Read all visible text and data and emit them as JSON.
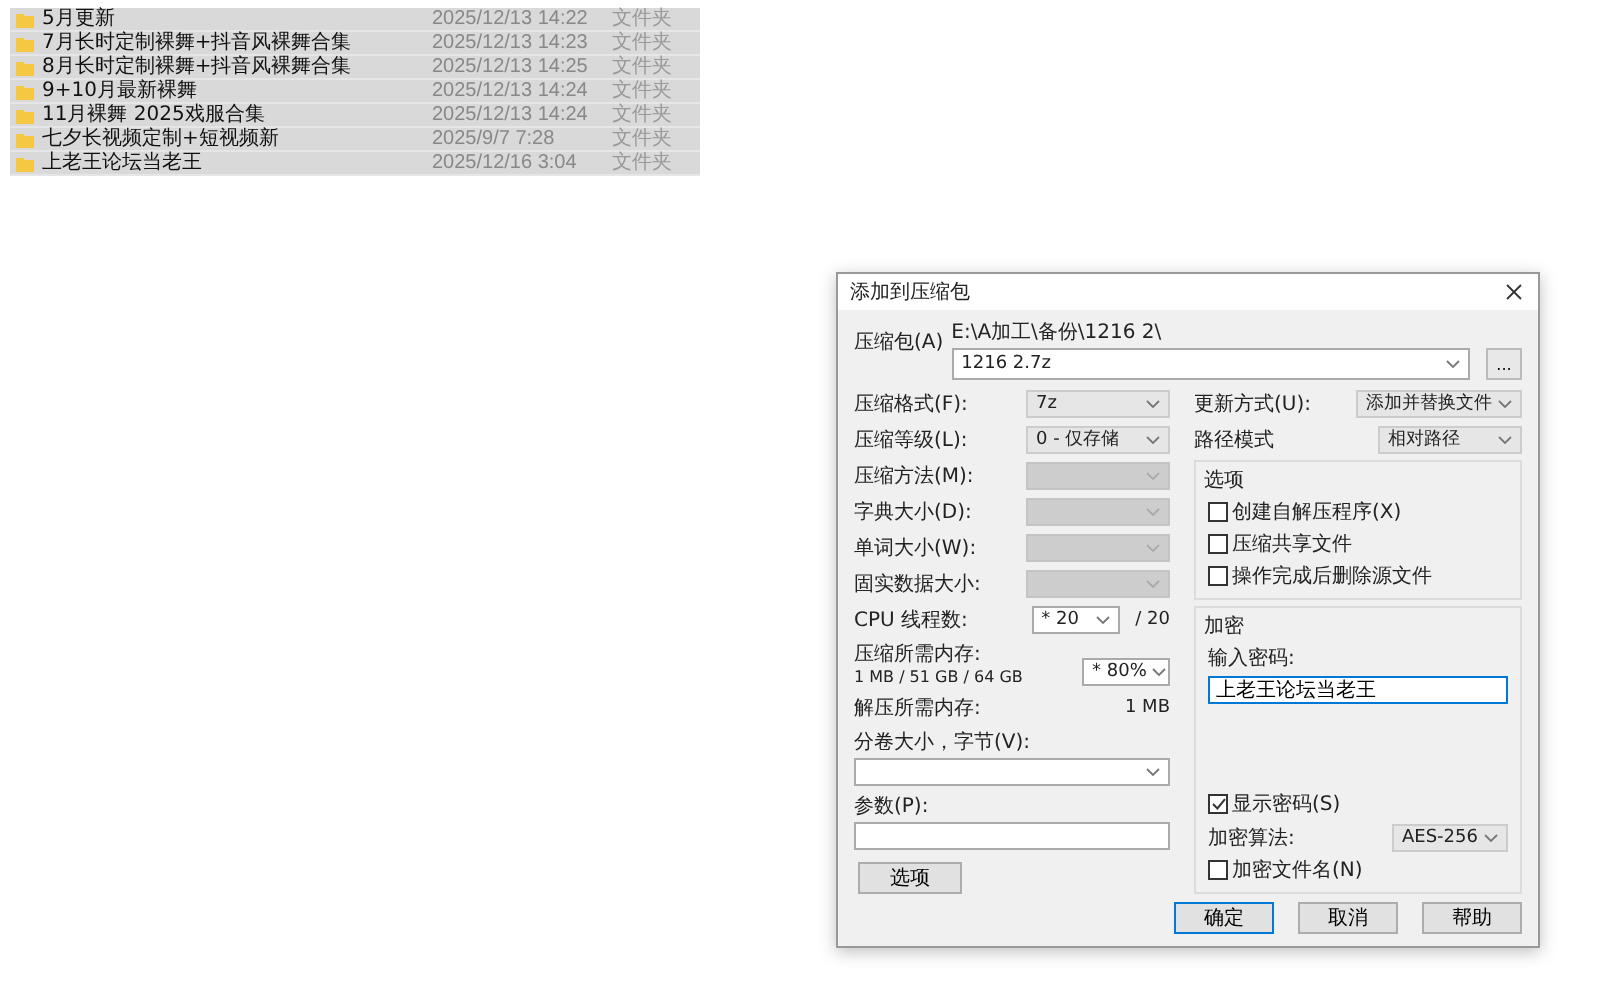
{
  "file_list": {
    "rows": [
      {
        "name": "5月更新",
        "date": "2025/12/13 14:22",
        "type": "文件夹",
        "selected": true
      },
      {
        "name": "7月长时定制裸舞+抖音风裸舞合集",
        "date": "2025/12/13 14:23",
        "type": "文件夹",
        "selected": true
      },
      {
        "name": "8月长时定制裸舞+抖音风裸舞合集",
        "date": "2025/12/13 14:25",
        "type": "文件夹",
        "selected": true
      },
      {
        "name": "9+10月最新裸舞",
        "date": "2025/12/13 14:24",
        "type": "文件夹",
        "selected": true
      },
      {
        "name": "11月裸舞 2025戏服合集",
        "date": "2025/12/13 14:24",
        "type": "文件夹",
        "selected": true
      },
      {
        "name": "七夕长视频定制+短视频新",
        "date": "2025/9/7 7:28",
        "type": "文件夹",
        "selected": true
      },
      {
        "name": "上老王论坛当老王",
        "date": "2025/12/16 3:04",
        "type": "文件夹",
        "selected": true
      }
    ]
  },
  "dialog": {
    "title": "添加到压缩包",
    "archive": {
      "label": "压缩包(A)",
      "path": "E:\\A加工\\备份\\1216 2\\",
      "value": "1216 2.7z",
      "browse": "..."
    },
    "left_fields": [
      {
        "kind": "select",
        "label": "压缩格式(F):",
        "value": "7z",
        "disabled": false
      },
      {
        "kind": "select",
        "label": "压缩等级(L):",
        "value": "0 - 仅存储",
        "disabled": false
      },
      {
        "kind": "select",
        "label": "压缩方法(M):",
        "disabled": true
      },
      {
        "kind": "select",
        "label": "字典大小(D):",
        "disabled": true
      },
      {
        "kind": "select",
        "label": "单词大小(W):",
        "disabled": true
      },
      {
        "kind": "select",
        "label": "固实数据大小:",
        "disabled": true
      },
      {
        "kind": "threads",
        "label": "CPU 线程数:",
        "value": "* 20",
        "suffix": "/ 20"
      },
      {
        "kind": "memory",
        "label": "压缩所需内存:",
        "note": "1 MB / 51 GB / 64 GB",
        "value": "* 80%"
      },
      {
        "kind": "info",
        "label": "解压所需内存:",
        "value": "1 MB"
      },
      {
        "kind": "combo",
        "label": "分卷大小，字节(V):"
      },
      {
        "kind": "input",
        "label": "参数(P):"
      }
    ],
    "options_button": "选项",
    "update_mode": {
      "label": "更新方式(U):",
      "value": "添加并替换文件"
    },
    "path_mode": {
      "label": "路径模式",
      "value": "相对路径"
    },
    "options_group": {
      "title": "选项",
      "items": [
        {
          "label": "创建自解压程序(X)",
          "checked": false
        },
        {
          "label": "压缩共享文件",
          "checked": false
        },
        {
          "label": "操作完成后删除源文件",
          "checked": false
        }
      ]
    },
    "encryption": {
      "title": "加密",
      "password_label": "输入密码:",
      "password": "上老王论坛当老王",
      "show_password": {
        "label": "显示密码(S)",
        "checked": true
      },
      "method_label": "加密算法:",
      "method": "AES-256",
      "encrypt_names": {
        "label": "加密文件名(N)",
        "checked": false
      }
    },
    "buttons": [
      {
        "label": "确定",
        "default": true
      },
      {
        "label": "取消",
        "default": false
      },
      {
        "label": "帮助",
        "default": false
      }
    ]
  }
}
